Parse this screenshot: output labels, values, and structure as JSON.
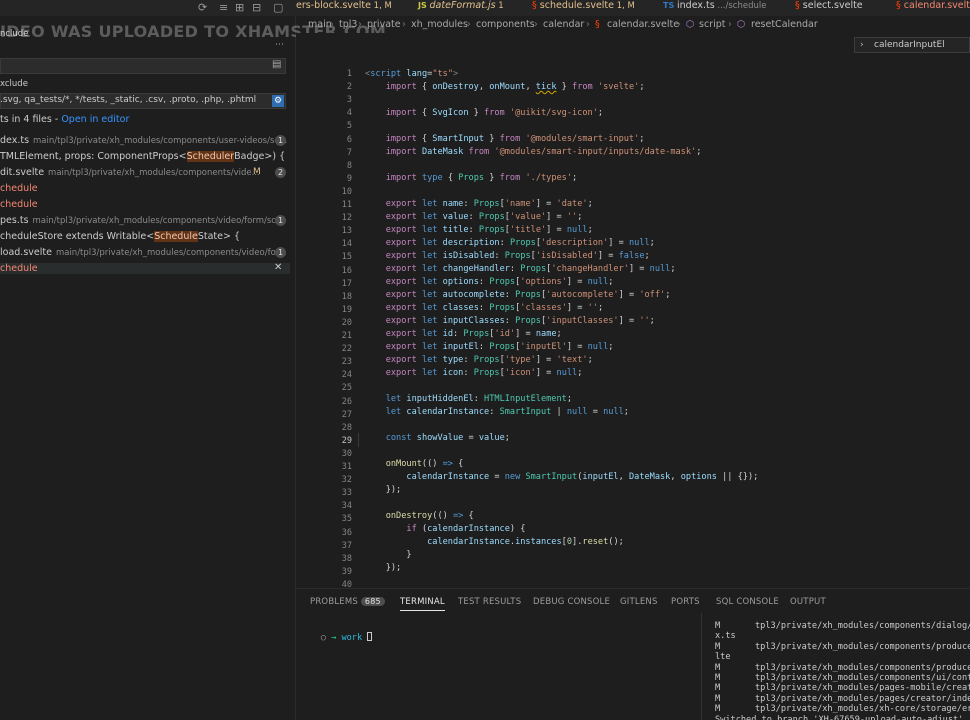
{
  "watermark": "IDEO WAS UPLOADED TO XHAMSTER.COM",
  "tabs": [
    {
      "label": "ers-block.svelte",
      "mod": " 1, M",
      "color": "#e2c08d"
    },
    {
      "label": "dateFormat.js",
      "mod": " 1",
      "color": "#e2c08d"
    },
    {
      "label": "schedule.svelte",
      "mod": " 1, M",
      "color": "#e2c08d"
    },
    {
      "label": "index.ts",
      "mod": " .../schedule",
      "color": "#cccccc"
    },
    {
      "label": "select.svelte",
      "mod": "",
      "color": "#cccccc"
    },
    {
      "label": "calendar.svelte",
      "mod": "",
      "color": "#f48771"
    }
  ],
  "breadcrumb": [
    "main",
    "tpl3",
    "private",
    "xh_modules",
    "components",
    "calendar",
    "calendar.svelte",
    "script",
    "resetCalendar"
  ],
  "find_widget": "calendarInputEl",
  "sidebar": {
    "include_label": "nclude",
    "exclude_label": "xclude",
    "exclude_value": ".svg, qa_tests/*, */tests, _static, .csv, .proto, .php, .phtml",
    "results_summary": "ts in 4 files - ",
    "open_in_editor": "Open in editor",
    "results": [
      {
        "file": "dex.ts",
        "path": "main/tpl3/private/xh_modules/components/user-videos/sc...",
        "count": "1"
      },
      {
        "pre": "TMLElement, props: ComponentProps<",
        "match": "Scheduler",
        "post": "Badge>) {"
      },
      {
        "file": "dit.svelte",
        "path": "main/tpl3/private/xh_modules/components/vide...",
        "count": "2",
        "mod": "M"
      },
      {
        "match": "chedule"
      },
      {
        "match": "chedule"
      },
      {
        "file": "pes.ts",
        "path": "main/tpl3/private/xh_modules/components/video/form/sc...",
        "count": "1"
      },
      {
        "pre": "cheduleStore extends Writable<",
        "match": "Schedule",
        "post": "State> {"
      },
      {
        "file": "load.svelte",
        "path": "main/tpl3/private/xh_modules/components/video/for...",
        "count": "1"
      },
      {
        "match": "chedule"
      }
    ]
  },
  "editor": {
    "current_line": 29,
    "line_numbers": [
      "1",
      "2",
      "3",
      "4",
      "5",
      "6",
      "7",
      "8",
      "9",
      "10",
      "11",
      "12",
      "13",
      "14",
      "15",
      "16",
      "17",
      "18",
      "19",
      "20",
      "21",
      "22",
      "23",
      "24",
      "25",
      "26",
      "27",
      "28",
      "29",
      "30",
      "31",
      "32",
      "33",
      "34",
      "35",
      "36",
      "37",
      "38",
      "39",
      "40"
    ]
  },
  "panel": {
    "tabs": [
      "PROBLEMS",
      "TERMINAL",
      "TEST RESULTS",
      "DEBUG CONSOLE",
      "GITLENS",
      "PORTS",
      "SQL CONSOLE",
      "OUTPUT"
    ],
    "problems_count": "685",
    "active_tab": "TERMINAL",
    "prompt_dir": "work",
    "git_lines": [
      [
        "M",
        "tpl3/private/xh_modules/components/dialog/"
      ],
      [
        "x.ts",
        ""
      ],
      [
        "M",
        "tpl3/private/xh_modules/components/produce"
      ],
      [
        "lte",
        ""
      ],
      [
        "M",
        "tpl3/private/xh_modules/components/produce"
      ],
      [
        "M",
        "tpl3/private/xh_modules/components/ui/cont"
      ],
      [
        "M",
        "tpl3/private/xh_modules/pages-mobile/creat"
      ],
      [
        "M",
        "tpl3/private/xh_modules/pages/creator/inde"
      ],
      [
        "M",
        "tpl3/private/xh_modules/xh-core/storage/er"
      ],
      [
        "Switched to branch 'XH-67659-upload-auto-adjust'",
        ""
      ]
    ]
  }
}
